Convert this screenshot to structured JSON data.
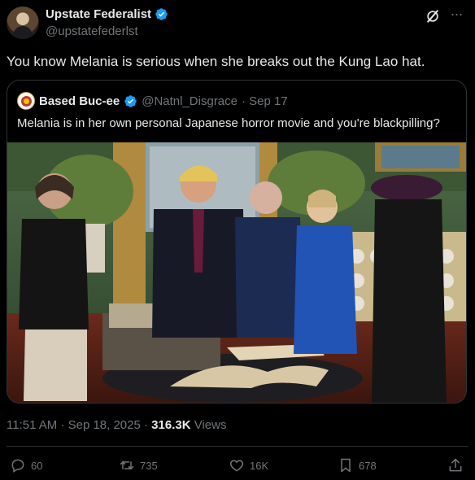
{
  "author": {
    "display_name": "Upstate Federalist",
    "handle": "@upstatefederlst"
  },
  "icons": {
    "verified": "verified-badge-icon",
    "grok": "grok-icon",
    "more": "more-icon",
    "reply": "reply-icon",
    "retweet": "retweet-icon",
    "like": "like-icon",
    "bookmark": "bookmark-icon",
    "share": "share-icon"
  },
  "tweet_text": "You know Melania is serious when she breaks out the Kung Lao hat.",
  "quote": {
    "display_name": "Based Buc-ee",
    "handle": "@Natnl_Disgrace",
    "date": "· Sep 17",
    "text": "Melania is in her own personal Japanese horror movie and you're blackpilling?"
  },
  "meta": {
    "time": "11:51 AM · Sep 18, 2025 · ",
    "views_count": "316.3K",
    "views_label": " Views"
  },
  "actions": {
    "replies": "60",
    "retweets": "735",
    "likes": "16K",
    "bookmarks": "678"
  },
  "colors": {
    "background": "#000000",
    "text_primary": "#e7e9ea",
    "text_secondary": "#71767b",
    "border": "#2f3336",
    "verified_blue": "#1d9bf0"
  }
}
